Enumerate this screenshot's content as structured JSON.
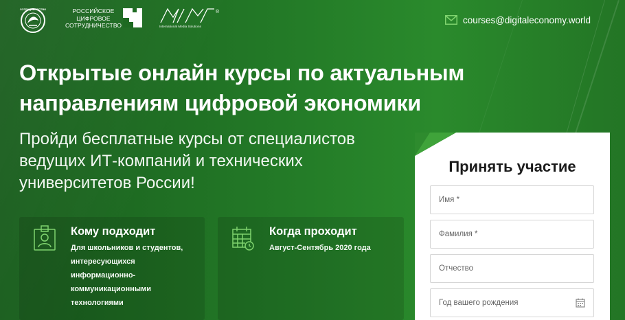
{
  "header": {
    "logo_round_alt": "РЕСПУБЛИКАНСКОЕ СОТРУДНИЧЕСТВО",
    "rct_line1": "РОССИЙСКОЕ",
    "rct_line2": "ЦИФРОВОЕ",
    "rct_line3": "СОТРУДНИЧЕСТВО",
    "ims_logo": "IMS",
    "ims_sub": "International Media Solutions",
    "email": "courses@digitaleconomy.world",
    "mail_icon": "mail-icon"
  },
  "hero": {
    "title": "Открытые онлайн курсы по актуальным направлениям цифровой экономики",
    "subtitle": "Пройди бесплатные курсы от специалистов ведущих ИТ-компаний и технических университетов России!"
  },
  "cards": [
    {
      "icon": "id-card-icon",
      "heading": "Кому подходит",
      "text": "Для школьников и студентов, интересующихся информационно-коммуникационными технологиями"
    },
    {
      "icon": "calendar-clock-icon",
      "heading": "Когда проходит",
      "text": "Август-Сентябрь 2020 года"
    }
  ],
  "form": {
    "title": "Принять участие",
    "first_name_placeholder": "Имя *",
    "last_name_placeholder": "Фамилия *",
    "patronymic_placeholder": "Отчество",
    "birthdate_placeholder": "Год вашего рождения",
    "accent_color": "#2e8b2e"
  }
}
